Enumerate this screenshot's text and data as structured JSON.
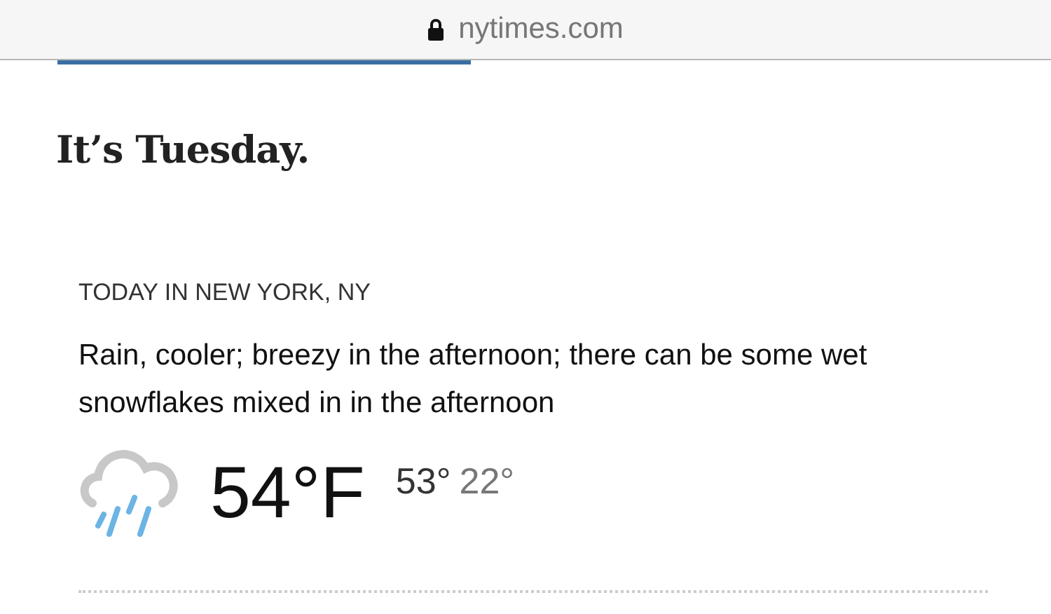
{
  "address_bar": {
    "secure": true,
    "url": "nytimes.com"
  },
  "heading": "It’s Tuesday.",
  "weather": {
    "location": "TODAY IN NEW YORK, NY",
    "forecast": "Rain, cooler; breezy in the afternoon; there can be some wet snowflakes mixed in in the afternoon",
    "raining": true,
    "temperature": "54°F",
    "high": "53°",
    "low": "22°"
  }
}
